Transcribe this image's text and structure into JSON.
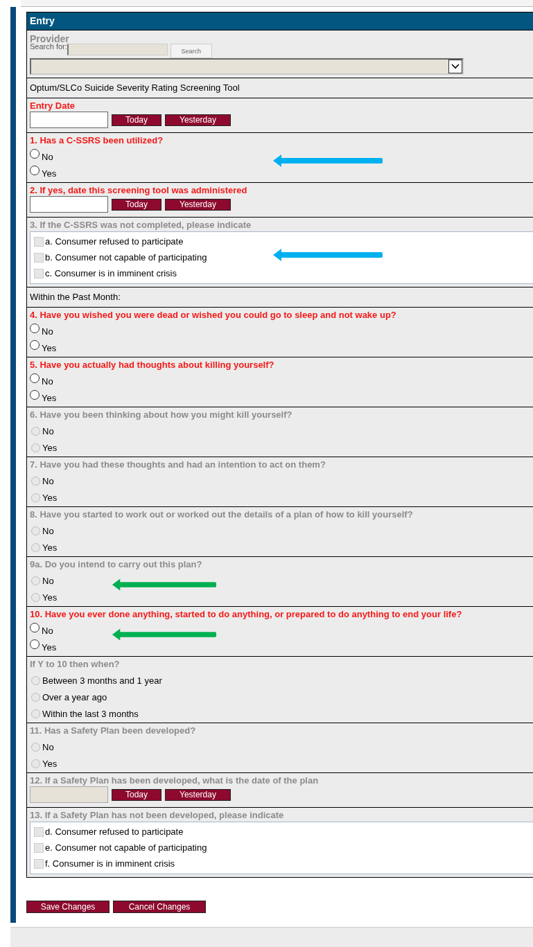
{
  "form": {
    "title": "Entry",
    "sections": [
      {
        "kind": "provider",
        "label": "Provider",
        "search_label": "Search for:",
        "search_button": "Search"
      },
      {
        "kind": "note",
        "text": "Optum/SLCo Suicide Severity Rating Screening Tool"
      },
      {
        "kind": "date",
        "label": "Entry Date",
        "required": true,
        "disabled": false,
        "buttons": [
          "Today",
          "Yesterday"
        ]
      },
      {
        "kind": "radio",
        "label": "1. Has a C-SSRS been utilized?",
        "required": true,
        "disabled": false,
        "arrow": {
          "kind": "far",
          "color": "#00b0f0"
        },
        "options": [
          {
            "label": "No",
            "selected": false
          },
          {
            "label": "Yes",
            "selected": false
          }
        ]
      },
      {
        "kind": "date",
        "label": "2. If yes, date this screening tool was administered",
        "required": true,
        "disabled": false,
        "buttons": [
          "Today",
          "Yesterday"
        ]
      },
      {
        "kind": "checks",
        "label": "3. If the C-SSRS was not completed, please indicate",
        "required": false,
        "disabled": true,
        "arrow": {
          "kind": "far",
          "color": "#00b0f0"
        },
        "options": [
          {
            "label": "a. Consumer refused to participate",
            "checked": false
          },
          {
            "label": "b. Consumer not capable of participating",
            "checked": false
          },
          {
            "label": "c. Consumer is in imminent crisis",
            "checked": false
          }
        ]
      },
      {
        "kind": "note",
        "text": "Within the Past Month:"
      },
      {
        "kind": "radio",
        "label": "4. Have you wished you were dead or wished you could go to sleep and not wake up?",
        "required": true,
        "disabled": false,
        "options": [
          {
            "label": "No",
            "selected": false
          },
          {
            "label": "Yes",
            "selected": false
          }
        ]
      },
      {
        "kind": "radio",
        "label": "5. Have you actually had thoughts about killing yourself?",
        "required": true,
        "disabled": false,
        "options": [
          {
            "label": "No",
            "selected": false
          },
          {
            "label": "Yes",
            "selected": false
          }
        ]
      },
      {
        "kind": "radio",
        "label": "6. Have you been thinking about how you might kill yourself?",
        "required": false,
        "disabled": true,
        "options": [
          {
            "label": "No",
            "selected": false
          },
          {
            "label": "Yes",
            "selected": false
          }
        ]
      },
      {
        "kind": "radio",
        "label": "7. Have you had these thoughts and had an intention to act on them?",
        "required": false,
        "disabled": true,
        "options": [
          {
            "label": "No",
            "selected": false
          },
          {
            "label": "Yes",
            "selected": false
          }
        ]
      },
      {
        "kind": "radio",
        "label": "8. Have you started to work out or worked out the details of a plan of how to kill yourself?",
        "required": false,
        "disabled": true,
        "options": [
          {
            "label": "No",
            "selected": false
          },
          {
            "label": "Yes",
            "selected": false
          }
        ]
      },
      {
        "kind": "radio",
        "label": "9a. Do you intend to carry out this plan?",
        "required": false,
        "disabled": true,
        "arrow": {
          "kind": "near",
          "color": "#00b050"
        },
        "options": [
          {
            "label": "No",
            "selected": false
          },
          {
            "label": "Yes",
            "selected": false
          }
        ]
      },
      {
        "kind": "radio",
        "label": "10. Have you ever done anything, started to do anything, or prepared to do anything to end your life?",
        "required": true,
        "disabled": false,
        "arrow": {
          "kind": "near",
          "color": "#00b050"
        },
        "options": [
          {
            "label": "No",
            "selected": false
          },
          {
            "label": "Yes",
            "selected": false
          }
        ]
      },
      {
        "kind": "radio",
        "label": "If Y to 10 then when?",
        "required": false,
        "disabled": true,
        "options": [
          {
            "label": "Between 3 months and 1 year",
            "selected": false
          },
          {
            "label": "Over a year ago",
            "selected": false
          },
          {
            "label": "Within the last 3 months",
            "selected": false
          }
        ]
      },
      {
        "kind": "radio",
        "label": "11. Has a Safety Plan been developed?",
        "required": false,
        "disabled": true,
        "options": [
          {
            "label": "No",
            "selected": false
          },
          {
            "label": "Yes",
            "selected": false
          }
        ]
      },
      {
        "kind": "date",
        "label": "12. If a Safety Plan has been developed, what is the date of the plan",
        "required": false,
        "disabled": true,
        "buttons": [
          "Today",
          "Yesterday"
        ]
      },
      {
        "kind": "checks",
        "label": "13. If a Safety Plan has not been developed, please indicate",
        "required": false,
        "disabled": true,
        "options": [
          {
            "label": "d. Consumer refused to participate",
            "checked": false
          },
          {
            "label": "e. Consumer not capable of participating",
            "checked": false
          },
          {
            "label": "f. Consumer is in imminent crisis",
            "checked": false
          }
        ]
      }
    ]
  },
  "actions": [
    "Save Changes",
    "Cancel Changes"
  ]
}
